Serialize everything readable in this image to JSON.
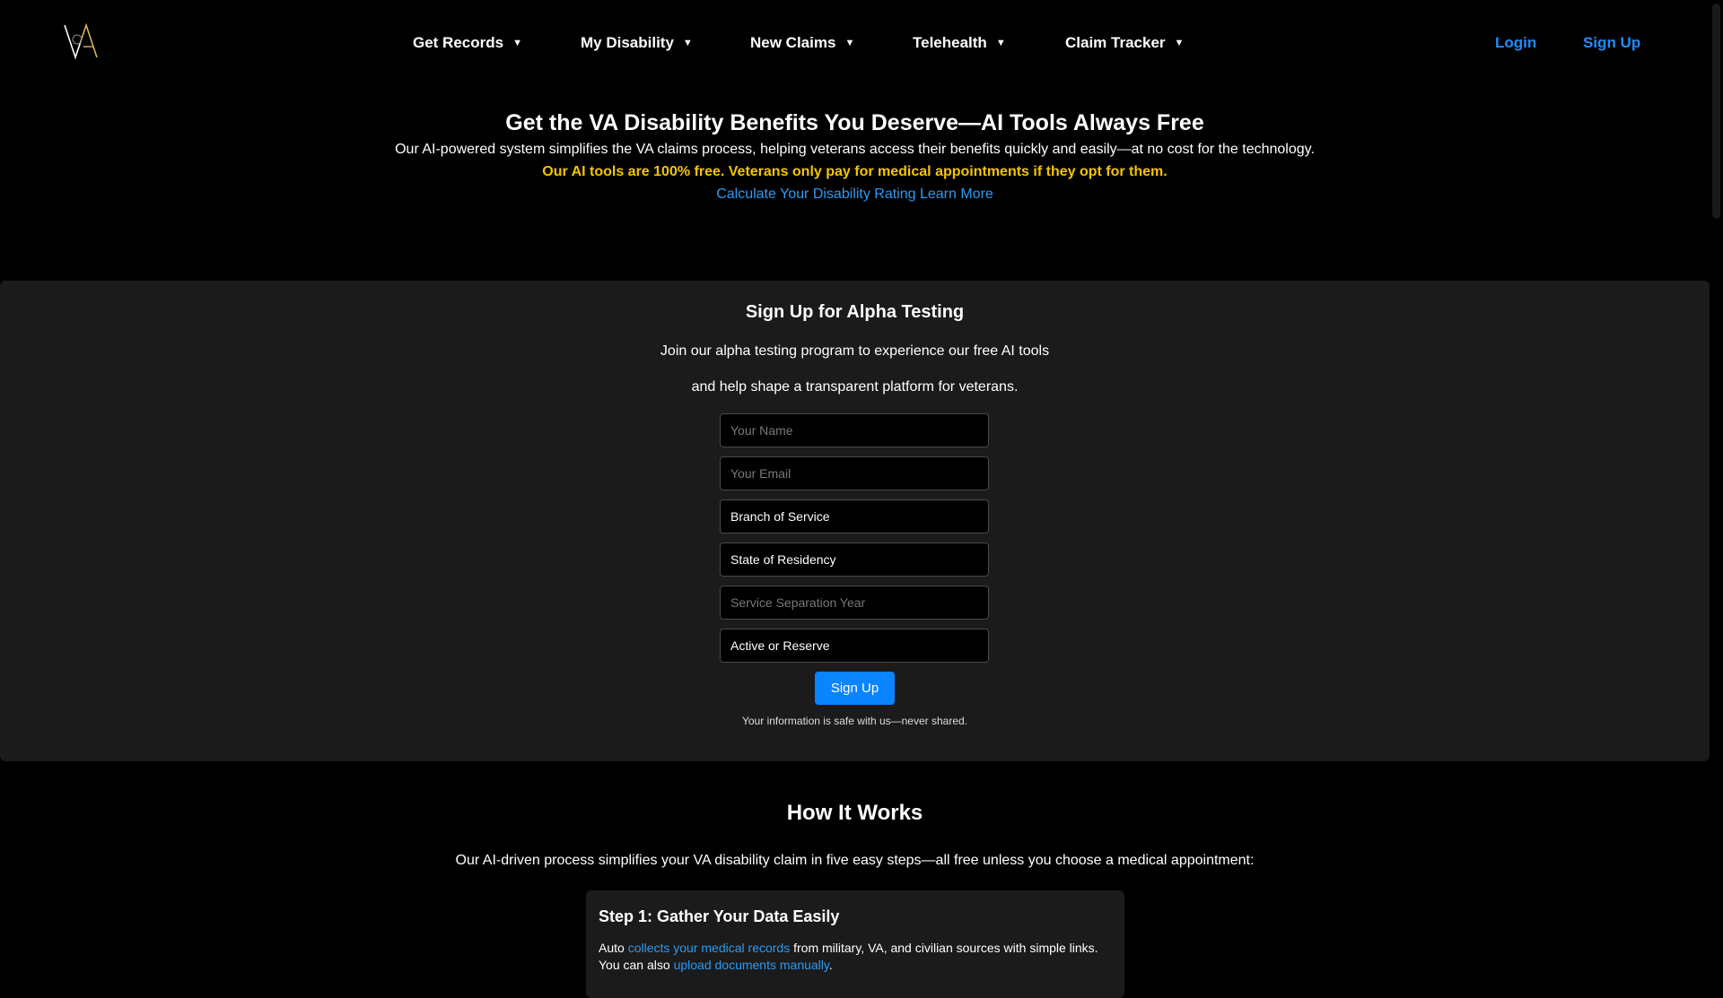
{
  "nav": {
    "logo_icon": "va-monogram-logo-icon",
    "menus": [
      {
        "label": "Get Records"
      },
      {
        "label": "My Disability"
      },
      {
        "label": "New Claims"
      },
      {
        "label": "Telehealth"
      },
      {
        "label": "Claim Tracker"
      }
    ],
    "caret": "▼",
    "login_label": "Login",
    "signup_label": "Sign Up"
  },
  "hero": {
    "title": "Get the VA Disability Benefits You Deserve—AI Tools Always Free",
    "intro": "Our AI-powered system simplifies the VA claims process, helping veterans access their benefits quickly and easily—at no cost for the technology.",
    "free_note": "Our AI tools are 100% free. Veterans only pay for medical appointments if they opt for them.",
    "calc_link": "Calculate Your Disability Rating",
    "learn_link": "Learn More"
  },
  "signup": {
    "title": "Sign Up for Alpha Testing",
    "desc_line1": "Join our alpha testing program to experience our free AI tools",
    "desc_line2": "and help shape a transparent platform for veterans.",
    "name_placeholder": "Your Name",
    "email_placeholder": "Your Email",
    "branch_select": "Branch of Service",
    "state_select": "State of Residency",
    "year_placeholder": "Service Separation Year",
    "status_select": "Active or Reserve",
    "button_label": "Sign Up",
    "privacy": "Your information is safe with us—never shared."
  },
  "how": {
    "title": "How It Works",
    "intro": "Our AI-driven process simplifies your VA disability claim in five easy steps—all free unless you choose a medical appointment:",
    "steps": [
      {
        "title": "Step 1: Gather Your Data Easily",
        "text_before": "Auto ",
        "link1": "collects your medical records",
        "text_middle": " from military, VA, and civilian sources with simple links. You can also ",
        "link2": "upload documents manually",
        "text_after": "."
      }
    ]
  },
  "colors": {
    "accent_link": "#2b9af3",
    "auth_link": "#1e8cff",
    "highlight": "#f5c400",
    "button": "#0a84ff",
    "panel": "#1b1b1b"
  }
}
